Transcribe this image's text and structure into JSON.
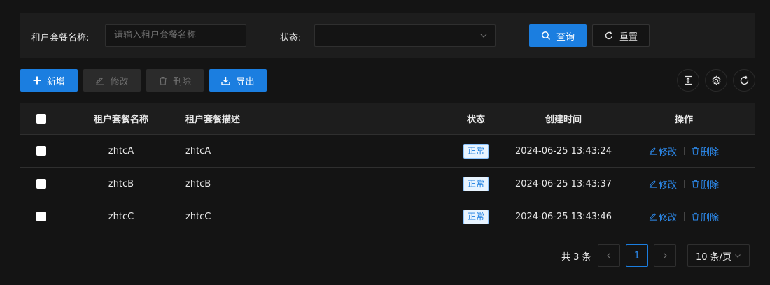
{
  "search": {
    "name_label": "租户套餐名称:",
    "name_placeholder": "请输入租户套餐名称",
    "status_label": "状态:",
    "status_value": "",
    "query_label": "查询",
    "reset_label": "重置"
  },
  "toolbar": {
    "add_label": "新增",
    "edit_label": "修改",
    "delete_label": "删除",
    "export_label": "导出"
  },
  "table": {
    "columns": [
      "租户套餐名称",
      "租户套餐描述",
      "状态",
      "创建时间",
      "操作"
    ],
    "rows": [
      {
        "name": "zhtcA",
        "desc": "zhtcA",
        "status": "正常",
        "created": "2024-06-25 13:43:24"
      },
      {
        "name": "zhtcB",
        "desc": "zhtcB",
        "status": "正常",
        "created": "2024-06-25 13:43:37"
      },
      {
        "name": "zhtcC",
        "desc": "zhtcC",
        "status": "正常",
        "created": "2024-06-25 13:43:46"
      }
    ],
    "op_edit": "修改",
    "op_delete": "删除"
  },
  "pagination": {
    "total": "共 3 条",
    "current_page": "1",
    "page_size": "10 条/页"
  },
  "colors": {
    "primary": "#1b7ee0",
    "link": "#2d8cf0",
    "background": "#141414",
    "panel": "#1d1d1d"
  }
}
